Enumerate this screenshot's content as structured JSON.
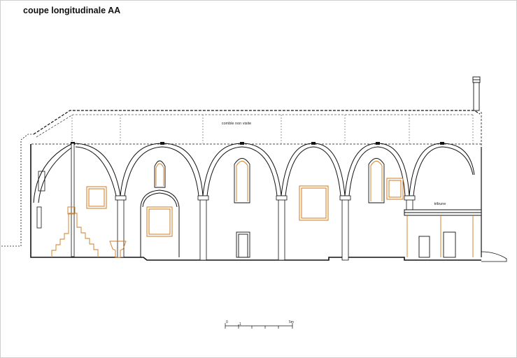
{
  "title": "coupe longitudinale AA",
  "labels": {
    "attic": "comble non visite",
    "gallery": "tribune"
  },
  "scale": {
    "ticks": [
      "0",
      "1",
      "5m"
    ]
  },
  "colors": {
    "line": "#111111",
    "highlight": "#d17a1e"
  }
}
